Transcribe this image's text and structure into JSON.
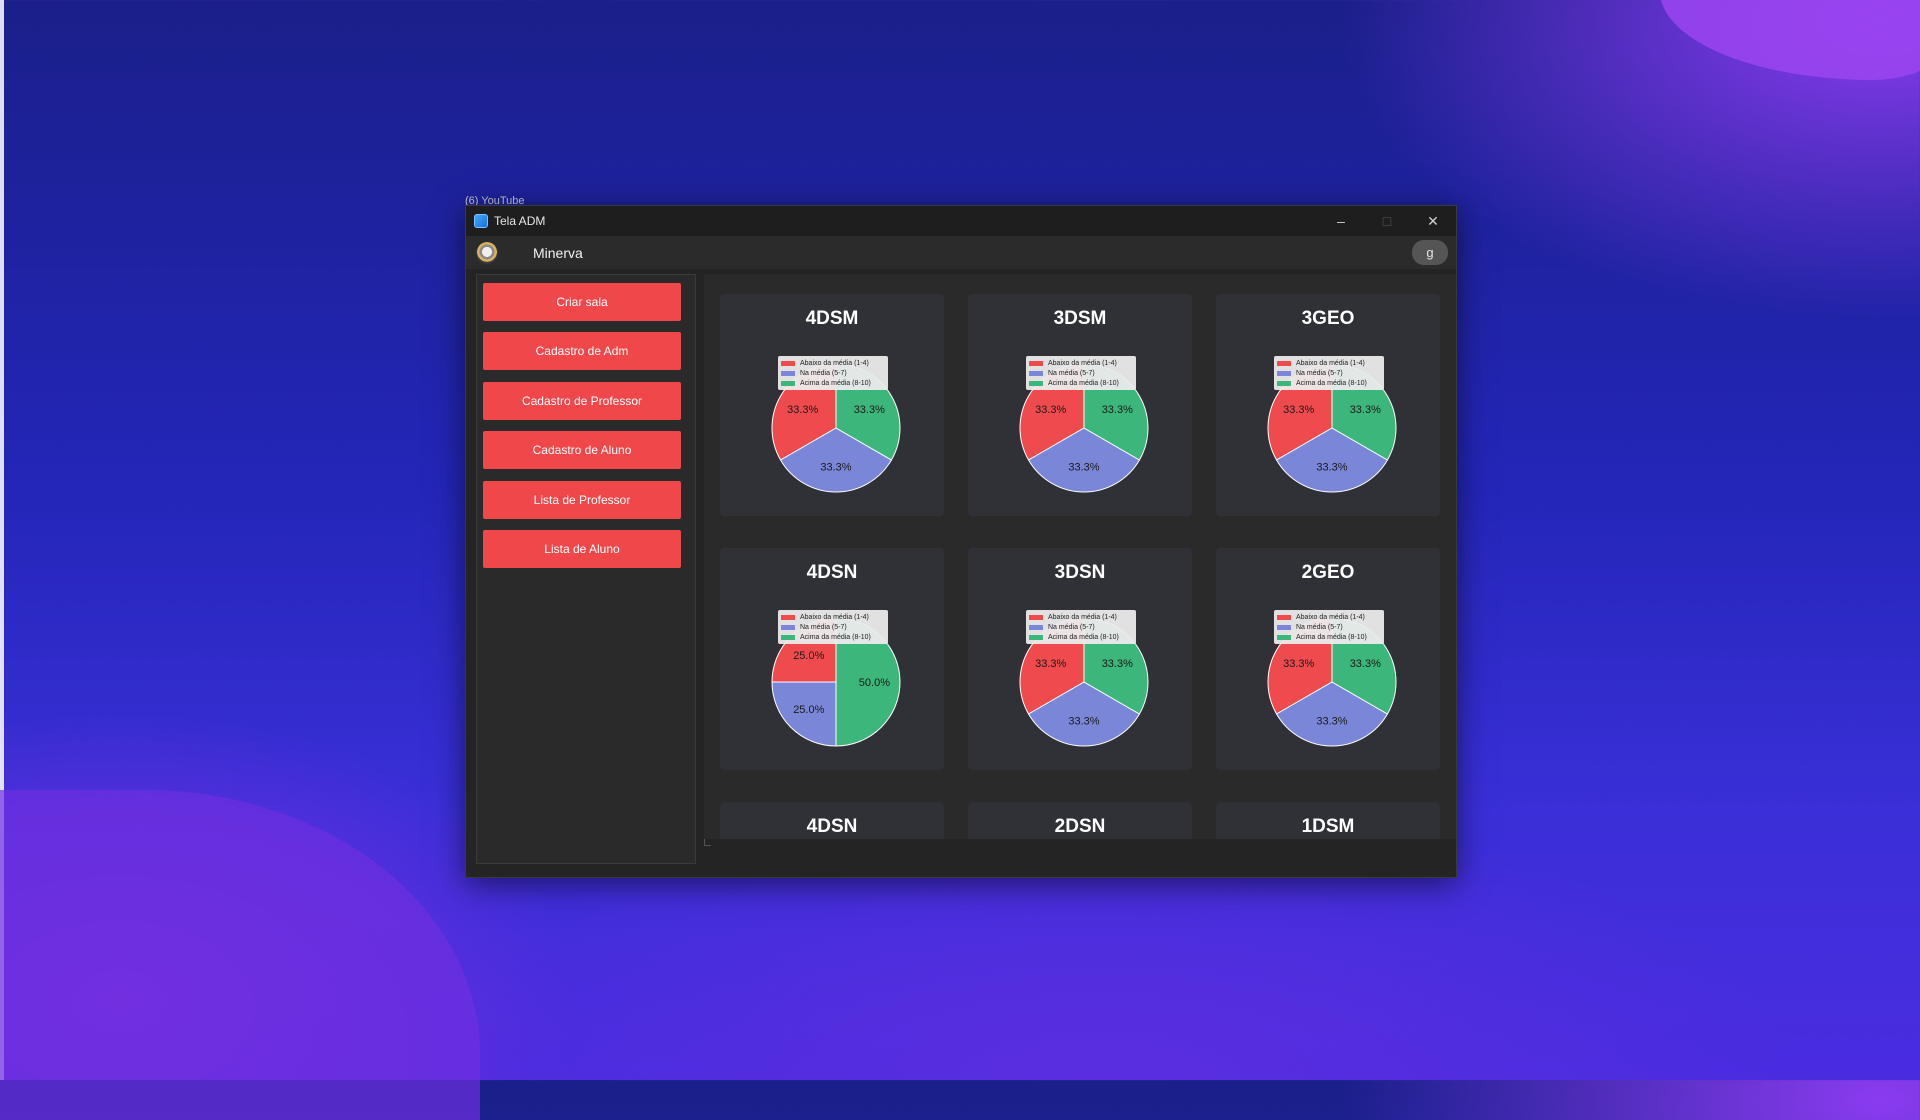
{
  "window": {
    "title": "Tela ADM",
    "minimize_icon": "minimize-icon",
    "maximize_icon": "maximize-icon",
    "close_icon": "close-icon"
  },
  "background_tab_label": "(6) YouTube",
  "topbar": {
    "brand": "Minerva",
    "user_initial": "g"
  },
  "sidebar": {
    "items": [
      {
        "label": "Criar sala"
      },
      {
        "label": "Cadastro de Adm"
      },
      {
        "label": "Cadastro de Professor"
      },
      {
        "label": "Cadastro de Aluno"
      },
      {
        "label": "Lista de Professor"
      },
      {
        "label": "Lista de Aluno"
      }
    ]
  },
  "legend": {
    "labels": [
      "Abaixo da média (1-4)",
      "Na média (5-7)",
      "Acima da média (8-10)"
    ],
    "colors": [
      "#ef4a4d",
      "#7a86d8",
      "#3cb67a"
    ]
  },
  "chart_data": [
    {
      "type": "pie",
      "title": "4DSM",
      "categories": [
        "Abaixo da média (1-4)",
        "Na média (5-7)",
        "Acima da média (8-10)"
      ],
      "values": [
        33.3,
        33.3,
        33.3
      ]
    },
    {
      "type": "pie",
      "title": "3DSM",
      "categories": [
        "Abaixo da média (1-4)",
        "Na média (5-7)",
        "Acima da média (8-10)"
      ],
      "values": [
        33.3,
        33.3,
        33.3
      ]
    },
    {
      "type": "pie",
      "title": "3GEO",
      "categories": [
        "Abaixo da média (1-4)",
        "Na média (5-7)",
        "Acima da média (8-10)"
      ],
      "values": [
        33.3,
        33.3,
        33.3
      ]
    },
    {
      "type": "pie",
      "title": "4DSN",
      "categories": [
        "Abaixo da média (1-4)",
        "Na média (5-7)",
        "Acima da média (8-10)"
      ],
      "values": [
        25.0,
        25.0,
        50.0
      ]
    },
    {
      "type": "pie",
      "title": "3DSN",
      "categories": [
        "Abaixo da média (1-4)",
        "Na média (5-7)",
        "Acima da média (8-10)"
      ],
      "values": [
        33.3,
        33.3,
        33.3
      ]
    },
    {
      "type": "pie",
      "title": "2GEO",
      "categories": [
        "Abaixo da média (1-4)",
        "Na média (5-7)",
        "Acima da média (8-10)"
      ],
      "values": [
        33.3,
        33.3,
        33.3
      ]
    }
  ],
  "partial_cards": [
    "4DSN",
    "2DSN",
    "1DSM"
  ]
}
